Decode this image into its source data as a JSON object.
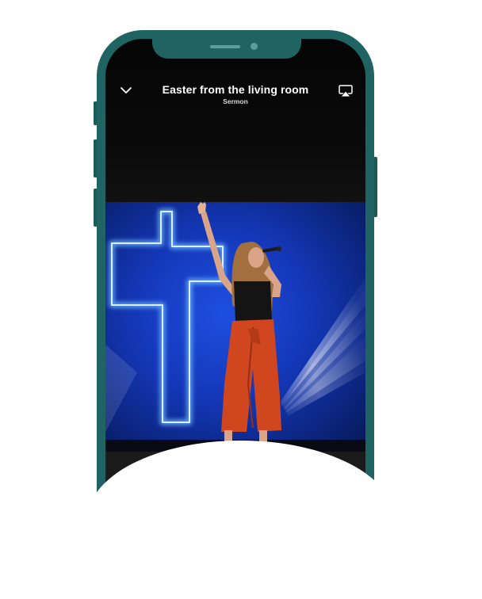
{
  "player": {
    "title": "Easter from the living room",
    "subtitle": "Sermon",
    "collapse_icon": "chevron-down-icon",
    "airplay_icon": "airplay-icon"
  },
  "colors": {
    "phone_frame": "#1f6363",
    "screen_bg": "#000000",
    "stage_blue": "#1238c8",
    "cross_glow": "#8fd0ff",
    "pants": "#d0461f"
  }
}
